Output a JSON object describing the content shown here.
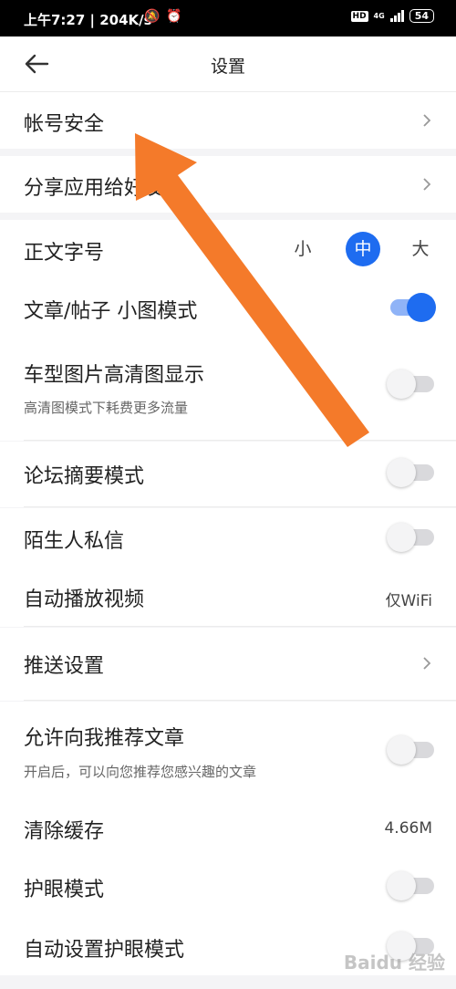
{
  "status_bar": {
    "time_speed": "上午7:27 | 204K/s",
    "hd": "HD",
    "network": "4G",
    "battery": "54"
  },
  "header": {
    "title": "设置"
  },
  "rows": {
    "account_security": {
      "label": "帐号安全"
    },
    "share_app": {
      "label": "分享应用给好友"
    },
    "font_size": {
      "label": "正文字号",
      "options": [
        "小",
        "中",
        "大"
      ],
      "selected": "中"
    },
    "small_image_mode": {
      "label": "文章/帖子 小图模式",
      "enabled": true
    },
    "hd_images": {
      "label": "车型图片高清图显示",
      "sub": "高清图模式下耗费更多流量",
      "enabled": false
    },
    "forum_summary": {
      "label": "论坛摘要模式",
      "enabled": false
    },
    "stranger_pm": {
      "label": "陌生人私信",
      "enabled": false
    },
    "autoplay_video": {
      "label": "自动播放视频",
      "value": "仅WiFi"
    },
    "push_settings": {
      "label": "推送设置"
    },
    "recommend_articles": {
      "label": "允许向我推荐文章",
      "sub": "开启后，可以向您推荐您感兴趣的文章",
      "enabled": false
    },
    "clear_cache": {
      "label": "清除缓存",
      "value": "4.66M"
    },
    "eye_care": {
      "label": "护眼模式",
      "enabled": false
    },
    "auto_eye_care": {
      "label": "自动设置护眼模式",
      "enabled": false
    }
  },
  "colors": {
    "accent": "#1e6cf0",
    "annotation_arrow": "#f47a2a"
  },
  "watermark": "Baidu 经验"
}
